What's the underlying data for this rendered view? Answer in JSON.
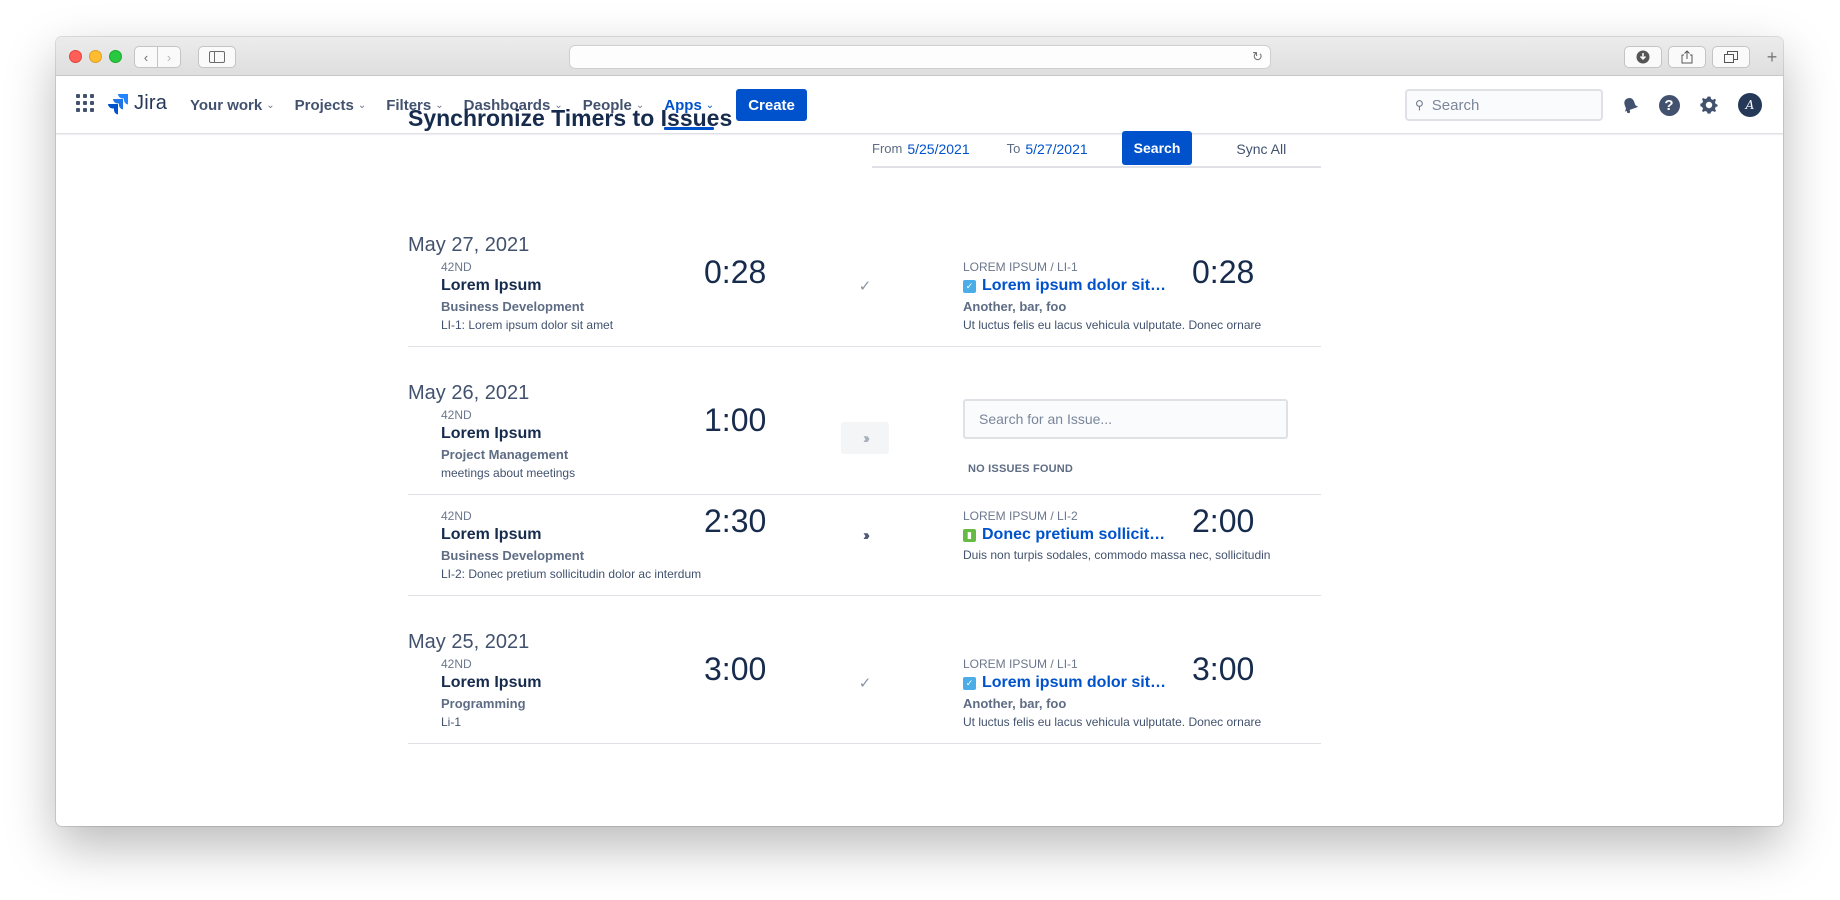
{
  "browser": {
    "address": ""
  },
  "nav": {
    "logo": "Jira",
    "items": [
      {
        "label": "Your work"
      },
      {
        "label": "Projects"
      },
      {
        "label": "Filters"
      },
      {
        "label": "Dashboards"
      },
      {
        "label": "People"
      },
      {
        "label": "Apps",
        "active": true
      }
    ],
    "create_label": "Create",
    "search_placeholder": "Search",
    "avatar_initials": "A"
  },
  "page": {
    "title": "Synchronize Timers to Issues",
    "filter": {
      "from_label": "From",
      "from_date": "5/25/2021",
      "to_label": "To",
      "to_date": "5/27/2021",
      "search_label": "Search",
      "sync_all_label": "Sync All"
    },
    "days": [
      {
        "date": "May 27, 2021"
      },
      {
        "date": "May 26, 2021"
      },
      {
        "date": "May 25, 2021"
      }
    ],
    "entries": [
      {
        "code": "42ND",
        "name": "Lorem Ipsum",
        "category": "Business Development",
        "description": "LI-1: Lorem ipsum dolor sit amet",
        "time": "0:28",
        "status": "synced",
        "issue": {
          "key": "LOREM IPSUM / LI-1",
          "type": "task",
          "title": "Lorem ipsum dolor sit amet",
          "labels": "Another, bar, foo",
          "description": "Ut luctus felis eu lacus vehicula vulputate. Donec ornare",
          "time": "0:28"
        }
      },
      {
        "code": "42ND",
        "name": "Lorem Ipsum",
        "category": "Project Management",
        "description": "meetings about meetings",
        "time": "1:00",
        "status": "unmatched",
        "issue_search_placeholder": "Search for an Issue...",
        "no_issues_text": "NO ISSUES FOUND"
      },
      {
        "code": "42ND",
        "name": "Lorem Ipsum",
        "category": "Business Development",
        "description": "LI-2: Donec pretium sollicitudin dolor ac interdum",
        "time": "2:30",
        "status": "pending",
        "issue": {
          "key": "LOREM IPSUM / LI-2",
          "type": "story",
          "title": "Donec pretium sollicitudin dolor",
          "labels": "",
          "description": "Duis non turpis sodales, commodo massa nec, sollicitudin",
          "time": "2:00"
        }
      },
      {
        "code": "42ND",
        "name": "Lorem Ipsum",
        "category": "Programming",
        "description": "Li-1",
        "time": "3:00",
        "status": "synced",
        "issue": {
          "key": "LOREM IPSUM / LI-1",
          "type": "task",
          "title": "Lorem ipsum dolor sit amet",
          "labels": "Another, bar, foo",
          "description": "Ut luctus felis eu lacus vehicula vulputate. Donec ornare",
          "time": "3:00"
        }
      }
    ]
  },
  "colors": {
    "primary": "#0052cc",
    "text": "#172b4d",
    "subtle": "#5e6c84",
    "border": "#dfe1e6"
  }
}
